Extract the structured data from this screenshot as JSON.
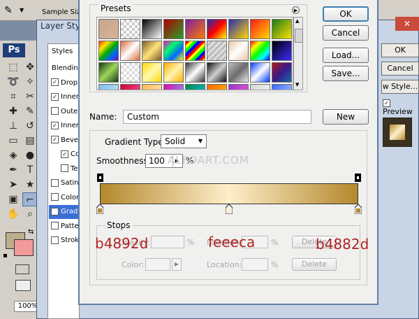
{
  "photoshop": {
    "options_bar_label": "Sample Size",
    "logo": "Ps",
    "zoom": "100%",
    "foreground_color": "#bfae8c",
    "background_color": "#f29a9a",
    "tools": [
      "marquee-icon",
      "move-icon",
      "lasso-icon",
      "magic-wand-icon",
      "crop-icon",
      "slice-icon",
      "healing-icon",
      "brush-icon",
      "stamp-icon",
      "history-brush-icon",
      "eraser-icon",
      "gradient-icon",
      "blur-icon",
      "dodge-icon",
      "pen-icon",
      "type-icon",
      "path-select-icon",
      "shape-icon",
      "notes-icon",
      "eyedropper-icon",
      "hand-icon",
      "zoom-icon"
    ]
  },
  "layer_style": {
    "title": "Layer Style",
    "styles_header": "Styles",
    "items": [
      {
        "label": "Blending",
        "checkbox": null,
        "checked": false
      },
      {
        "label": "Drop",
        "checkbox": true,
        "checked": true
      },
      {
        "label": "Inner",
        "checkbox": true,
        "checked": true
      },
      {
        "label": "Outer",
        "checkbox": true,
        "checked": false
      },
      {
        "label": "Inner",
        "checkbox": true,
        "checked": true
      },
      {
        "label": "Bevel",
        "checkbox": true,
        "checked": true
      },
      {
        "label": "Co",
        "checkbox": true,
        "checked": true
      },
      {
        "label": "Te",
        "checkbox": true,
        "checked": false
      },
      {
        "label": "Satin",
        "checkbox": true,
        "checked": false
      },
      {
        "label": "Color",
        "checkbox": true,
        "checked": false
      },
      {
        "label": "Grad",
        "checkbox": true,
        "checked": true
      },
      {
        "label": "Patte",
        "checkbox": true,
        "checked": false
      },
      {
        "label": "Strok",
        "checkbox": true,
        "checked": false
      }
    ],
    "ok": "OK",
    "cancel": "Cancel",
    "new_style": "w Style...",
    "preview_label": "Preview"
  },
  "gradient_editor": {
    "presets_label": "Presets",
    "buttons": {
      "ok": "OK",
      "cancel": "Cancel",
      "load": "Load...",
      "save": "Save...",
      "new": "New"
    },
    "name_label": "Name:",
    "name_value": "Custom",
    "gradient_type_label": "Gradient Type:",
    "gradient_type_value": "Solid",
    "smoothness_label": "Smoothness:",
    "smoothness_value": "100",
    "percent": "%",
    "stops_label": "Stops",
    "opacity_label": "Opacity:",
    "location_label": "Location:",
    "color_label": "Color:",
    "delete_label": "Delete",
    "gradient_colors": [
      "#b4892d",
      "#feeeca",
      "#b4882d"
    ],
    "color_stop_locations": [
      0,
      50,
      100
    ],
    "watermark": "ALFOART.COM",
    "preset_swatches": [
      "linear-gradient(135deg,#c9a58a,#d6b39a)",
      "repeating-conic-gradient(#ccc 0 25%,#fff 0 50%) 0 0/8px 8px",
      "linear-gradient(135deg,#000,#fff)",
      "linear-gradient(135deg,#b00000,#2aa02a)",
      "linear-gradient(135deg,#7a1fa0,#ff7a00)",
      "linear-gradient(135deg,#1c2fb0,#ff0000,#ffff00)",
      "linear-gradient(135deg,#2a2ab0,#ffd800)",
      "linear-gradient(135deg,#ff1a1a,#ffd800)",
      "linear-gradient(135deg,#1a7a1a,#ffe000)",
      "linear-gradient(135deg,#ff3300,#ffe600,#00aa00,#0066ff,#8800cc)",
      "linear-gradient(135deg,#d96a3b,#fff,#d96a3b)",
      "linear-gradient(135deg,#7a5a2a,#ffe27a,#7a5a2a)",
      "linear-gradient(135deg,#ff00cc,#00ff66,#0066ff,#ffff00)",
      "repeating-linear-gradient(135deg,#ff0000 0 4px,#ffff00 4px 8px,#00ff00 8px 12px,#0000ff 12px 16px)",
      "repeating-linear-gradient(135deg,#ddd 0 3px,#bbb 3px 6px)",
      "linear-gradient(135deg,#e9c8a4,#fff,#e9c8a4)",
      "linear-gradient(135deg,#ff0000,#ffff00,#00ff00,#00ffff,#0000ff)",
      "linear-gradient(135deg,#000,#3d2bff)",
      "linear-gradient(135deg,#1b3a14,#9bd65b,#1b3a14)",
      "repeating-conic-gradient(#dcdcdc 0 25%,#fff 0 50%) 0 0/8px 8px",
      "linear-gradient(135deg,#ffd800,#fff8b0,#ffd800)",
      "linear-gradient(135deg,#ffb000,#fff2b0,#ffb000)",
      "linear-gradient(135deg,#333,#fff,#333)",
      "linear-gradient(135deg,#111,#cfcfcf,#111)",
      "linear-gradient(135deg,#bfbfbf,#6b6b6b,#e6e6e6)",
      "linear-gradient(135deg,#003aff,#ffffff,#003aff)",
      "linear-gradient(135deg,#aa1a1a,#3a1a8a,#1a6aaa)",
      "linear-gradient(135deg,#7fbde6,#d6eaf6)",
      "linear-gradient(135deg,#cc0033,#ff66aa)",
      "linear-gradient(135deg,#ffb84d,#fff3d6)",
      "linear-gradient(135deg,#e600ac,#66ccff)",
      "linear-gradient(135deg,#008844,#00ccff)",
      "linear-gradient(135deg,#ff6600,#ffcc00)",
      "linear-gradient(135deg,#9933cc,#ff66cc)",
      "linear-gradient(135deg,#d5d5d5,#ffffff)",
      "linear-gradient(135deg,#3a66ff,#bfe0ff)"
    ]
  },
  "annotations": {
    "left": "b4892d",
    "center": "feeeca",
    "right": "b4882d",
    "color": "#b02323"
  }
}
